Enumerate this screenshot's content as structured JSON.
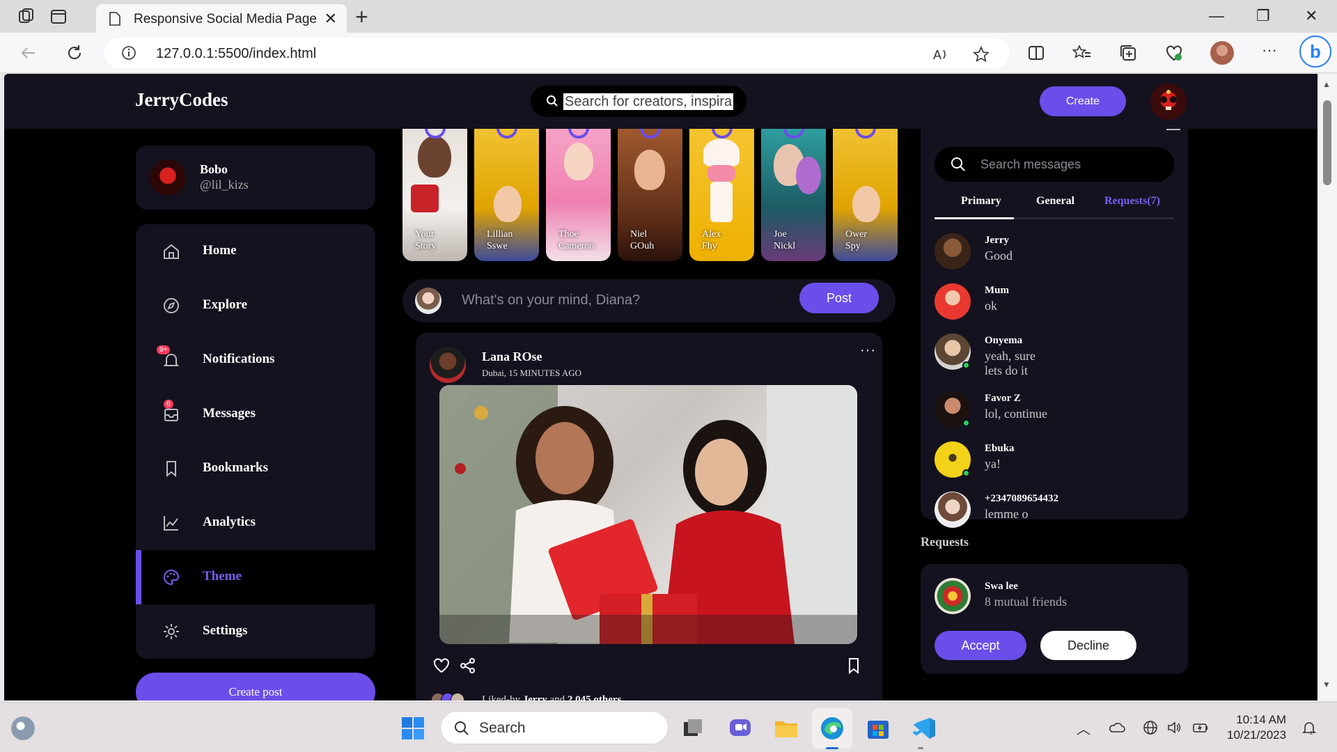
{
  "browser": {
    "tab_title": "Responsive Social Media Page",
    "url": "127.0.0.1:5500/index.html"
  },
  "app": {
    "logo": "JerryCodes",
    "search_placeholder": "Search for creators, inspirat",
    "create_label": "Create"
  },
  "profile": {
    "name": "Bobo",
    "handle": "@lil_kizs"
  },
  "sidebar": {
    "items": [
      {
        "label": "Home",
        "icon": "home-icon"
      },
      {
        "label": "Explore",
        "icon": "compass-icon"
      },
      {
        "label": "Notifications",
        "icon": "bell-icon",
        "badge": "9+"
      },
      {
        "label": "Messages",
        "icon": "envelope-icon",
        "badge": "6"
      },
      {
        "label": "Bookmarks",
        "icon": "bookmark-icon"
      },
      {
        "label": "Analytics",
        "icon": "chart-icon"
      },
      {
        "label": "Theme",
        "icon": "palette-icon"
      },
      {
        "label": "Settings",
        "icon": "gear-icon"
      }
    ],
    "active": "Theme",
    "create_post_label": "Create post"
  },
  "stories": [
    {
      "line1": "Your",
      "line2": "Story"
    },
    {
      "line1": "Lillian",
      "line2": "Sswe"
    },
    {
      "line1": "Thoe",
      "line2": "Cameron"
    },
    {
      "line1": "Niel",
      "line2": "GOuh"
    },
    {
      "line1": "Alex",
      "line2": "Fhy"
    },
    {
      "line1": "Joe",
      "line2": "Nickl"
    },
    {
      "line1": "Ower",
      "line2": "Spy"
    }
  ],
  "composer": {
    "placeholder": "What's on your mind, Diana?",
    "post_label": "Post"
  },
  "feed": {
    "author": "Lana ROse",
    "meta": "Dubai, 15 MINUTES AGO",
    "more": "···",
    "liked_prefix": "Liked-by ",
    "liked_name": "Jerry",
    "liked_mid": " and ",
    "liked_count": "2,045 others"
  },
  "messages": {
    "search_placeholder": "Search messages",
    "tabs": [
      "Primary",
      "General",
      "Requests(7)"
    ],
    "list": [
      {
        "name": "Jerry",
        "text": "Good",
        "online": false
      },
      {
        "name": "Mum",
        "text": "ok",
        "online": false
      },
      {
        "name": "Onyema",
        "text": "yeah, sure",
        "text2": "lets do it",
        "online": true
      },
      {
        "name": "Favor Z",
        "text": "lol, continue",
        "online": true
      },
      {
        "name": "Ebuka",
        "text": "ya!",
        "online": true
      },
      {
        "name": "+2347089654432",
        "text": "lemme o",
        "online": false
      }
    ]
  },
  "requests": {
    "heading": "Requests",
    "name": "Swa lee",
    "mutual": "8 mutual friends",
    "accept_label": "Accept",
    "decline_label": "Decline"
  },
  "taskbar": {
    "search_label": "Search",
    "time": "10:14 AM",
    "date": "10/21/2023"
  },
  "colors": {
    "accent": "#6b4dea",
    "panel": "#14121f",
    "background": "#000000"
  }
}
